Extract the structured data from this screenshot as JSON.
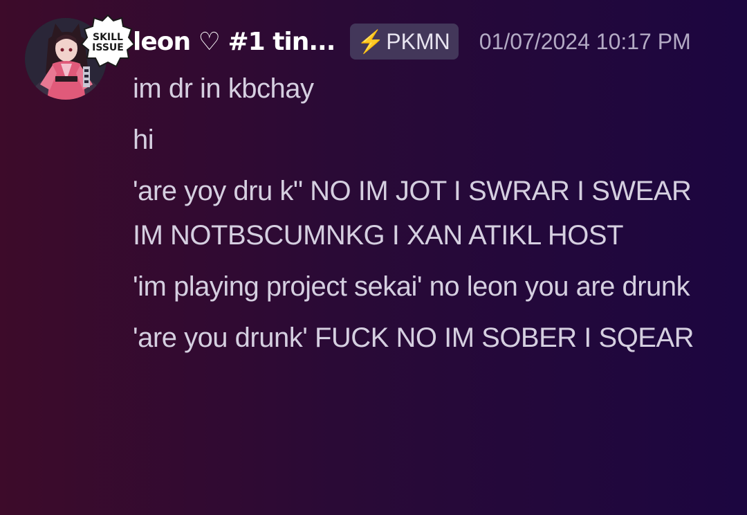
{
  "message": {
    "username": "leon ♡ #1 tin...",
    "tag": {
      "icon": "lightning-bolt-icon",
      "label": "PKMN",
      "icon_color": "#f4c21b"
    },
    "timestamp": "01/07/2024 10:17 PM",
    "avatar_decoration_text": "SKILL ISSUE",
    "lines": [
      "im dr in kbchay",
      "hi",
      "'are yoy dru k\" NO IM JOT I SWRAR I SWEAR IM NOTBSCUMNKG I XAN ATIKL HOST",
      "'im playing project sekai' no leon you are drunk",
      "'are you drunk' FUCK NO IM SOBER I SQEAR"
    ]
  },
  "colors": {
    "background_left": "#3d0b2a",
    "background_right": "#1c0640",
    "tag_background": "#43375a",
    "timestamp": "#b3aac4"
  }
}
